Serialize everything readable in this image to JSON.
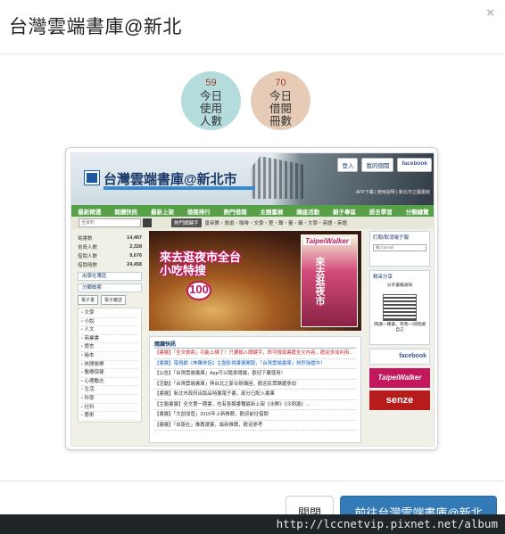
{
  "modal": {
    "title": "台灣雲端書庫@新北",
    "close_glyph": "×"
  },
  "stats": [
    {
      "value": "59",
      "label": "今日使用人數"
    },
    {
      "value": "70",
      "label": "今日借閱冊數"
    }
  ],
  "colors": {
    "stat_users_bg": "#b5dcdc",
    "stat_loans_bg": "#e6ccb6",
    "primary_button": "#337ab7",
    "site_nav_green": "#56a048"
  },
  "site": {
    "name": "台灣雲端書庫@新北市",
    "top_links": [
      "登入",
      "我的個閱",
      "facebook"
    ],
    "sub_links": "APP下載 | 使用說明 | 新北市立圖書館",
    "nav": [
      "最新精選",
      "閱讀快訊",
      "最新上架",
      "借閱排行",
      "熱門借閱",
      "主題書展",
      "講座活動",
      "親子專區",
      "語言學習",
      "分類總覽"
    ],
    "search_placeholder": "全資料",
    "hot_label": "熱門關鍵字",
    "hot_terms": "皇帝教・旅遊・咖啡・文學・登・聲・量・攝・文學・英語・英語",
    "counts": [
      {
        "label": "電書數",
        "value": "14,467"
      },
      {
        "label": "會員人數",
        "value": "2,328"
      },
      {
        "label": "借閱人數",
        "value": "9,676"
      },
      {
        "label": "借閱冊數",
        "value": "24,458"
      }
    ],
    "side_link": "出版社專區",
    "category_head": "分類檢索",
    "category_tabs": [
      "電子書",
      "電子雜誌"
    ],
    "categories": [
      "文學",
      "小說",
      "人文",
      "商業書",
      "語言",
      "繪本",
      "休閒娛樂",
      "醫療保健",
      "心理勵志",
      "生活",
      "科學",
      "社科",
      "藝術"
    ],
    "hero_title": "來去逛夜市全台小吃特搜",
    "hero_badge": "100",
    "magazine_title": "TaipeiWalker",
    "magazine_side": "來去逛夜市",
    "news_head": "閱讀快訊",
    "news": [
      {
        "text": "【書展】「全文檢索」功能上線了！只要輸入關鍵字，即可搜尋書籍全文內容，歡迎多加利用...",
        "tone": "red"
      },
      {
        "text": "【書展】電視劇《神雕俠侶》主題影視書展開跑，「台灣雲端書庫」熱烈強檔中！",
        "tone": "blue"
      },
      {
        "text": "【公告】「台灣雲端書庫」App可以隨身閱讀，歡迎下載使用！",
        "tone": "plain"
      },
      {
        "text": "【活動】「台灣雲端書庫」與台北之家合辦講座，歡迎民眾踴躍參加",
        "tone": "plain"
      },
      {
        "text": "【書展】新北市政府出版品特展電子書，部分已配入書庫",
        "tone": "plain"
      },
      {
        "text": "【主題書展】全文第一期書，也有各類書種最新上架《冰鮮》《冷刺激》...",
        "tone": "plain"
      },
      {
        "text": "【書展】「文創加值」2015年上新推薦，歡迎前往借閱",
        "tone": "plain"
      },
      {
        "text": "【書展】「出版社」推薦選書，最新推薦，歡迎參考",
        "tone": "plain"
      }
    ],
    "subscribe_head": "訂閱/取消電子報",
    "subscribe_placeholder": "輸入Email",
    "share_head": "精采分享",
    "share_caption": "分享書籍通知",
    "share_caption2": "閱讀一種書，帶我一同閱讀自己",
    "fb_badge": "facebook",
    "badge_tw": "TaipeiWalker",
    "badge_senze": "senze"
  },
  "footer": {
    "close_label": "關閉",
    "go_label": "前往台灣雲端書庫@新北"
  },
  "watermark": "http://lccnetvip.pixnet.net/album"
}
